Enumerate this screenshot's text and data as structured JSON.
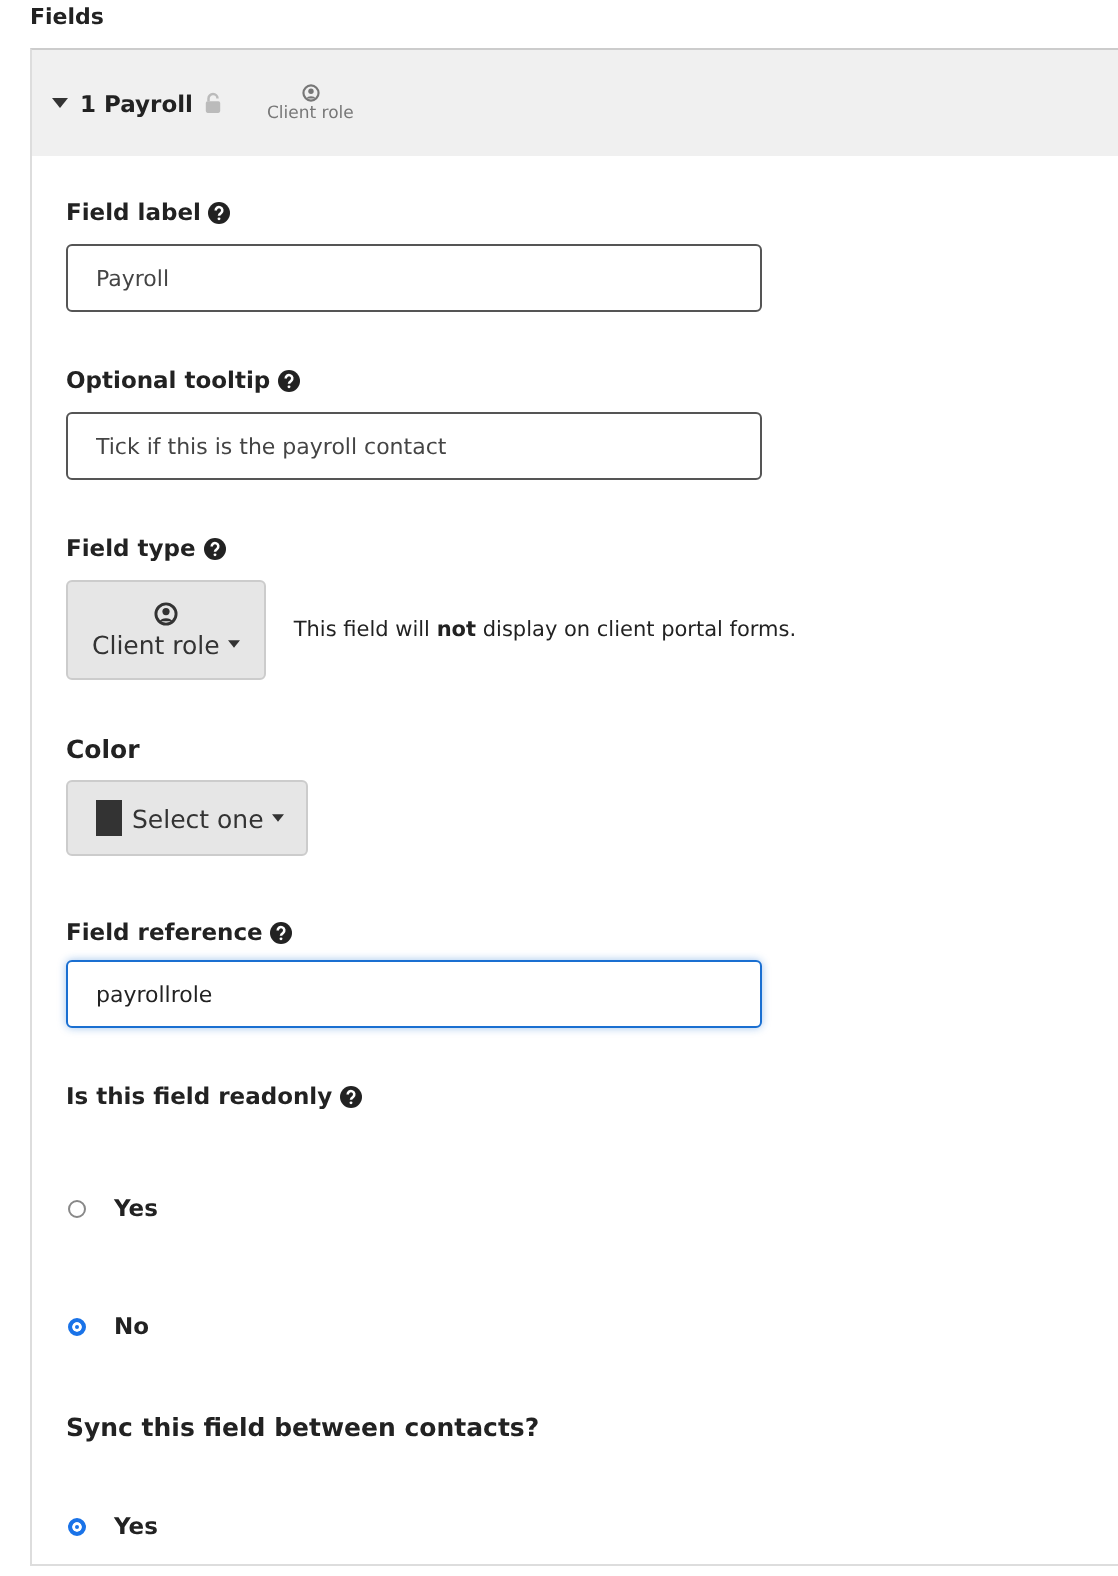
{
  "section_title": "Fields",
  "panel": {
    "expanded": true,
    "number": "1",
    "name": "Payroll",
    "locked": false,
    "type_label": "Client role"
  },
  "field_label": {
    "label": "Field label",
    "value": "Payroll"
  },
  "tooltip": {
    "label": "Optional tooltip",
    "value": "Tick if this is the payroll contact"
  },
  "field_type": {
    "label": "Field type",
    "button": "Client role",
    "note": "This field will **not** display on client portal forms."
  },
  "color": {
    "label": "Color",
    "button": "Select one"
  },
  "field_reference": {
    "label": "Field reference",
    "value": "payrollrole",
    "focused": true
  },
  "readonly": {
    "label": "Is this field readonly",
    "options": [
      {
        "label": "Yes",
        "selected": false
      },
      {
        "label": "No",
        "selected": true
      }
    ]
  },
  "sync": {
    "label": "Sync this field between contacts?",
    "options": [
      {
        "label": "Yes",
        "selected": true
      }
    ]
  }
}
